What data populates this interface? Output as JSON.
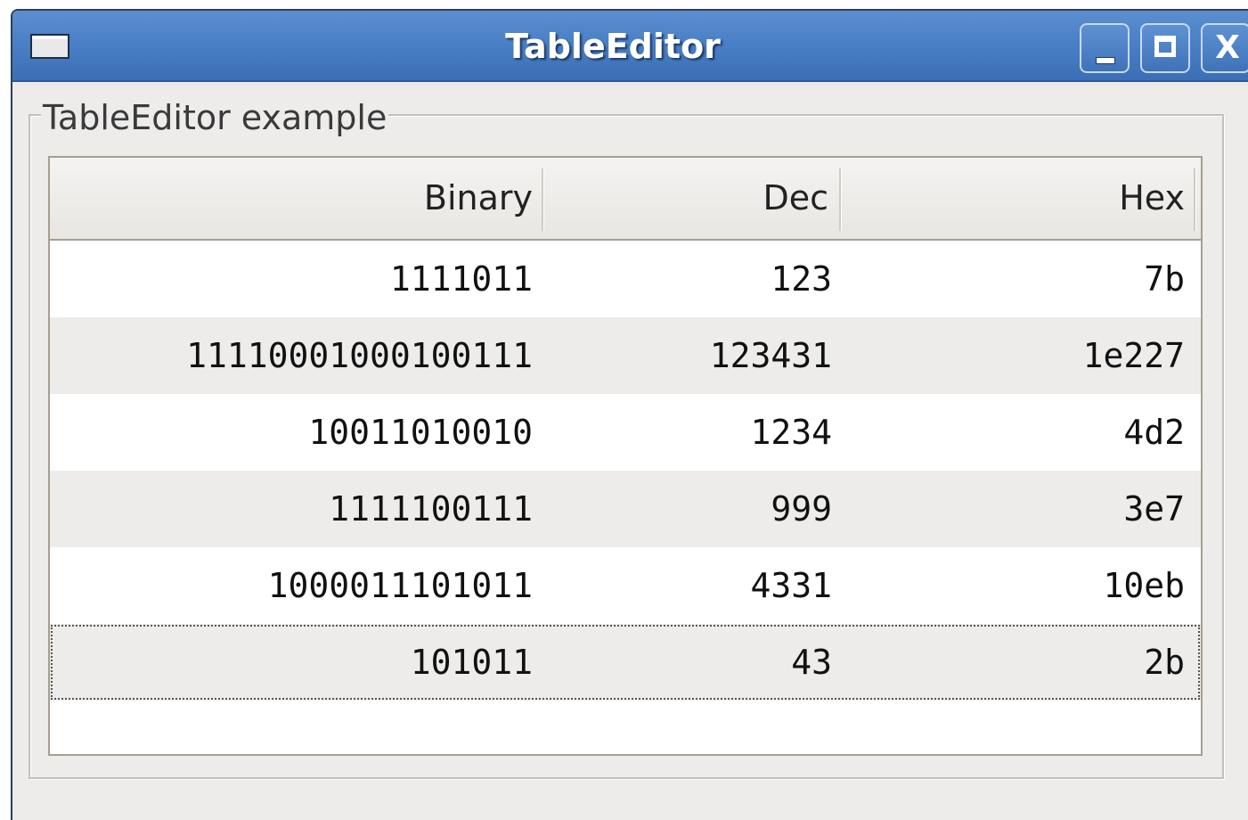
{
  "window": {
    "title": "TableEditor"
  },
  "titlebar": {
    "minimize_label": "_",
    "maximize_label": "",
    "close_label": "X"
  },
  "groupbox": {
    "title": "TableEditor example"
  },
  "table": {
    "columns": [
      "Binary",
      "Dec",
      "Hex"
    ],
    "rows": [
      {
        "binary": "1111011",
        "dec": "123",
        "hex": "7b"
      },
      {
        "binary": "11110001000100111",
        "dec": "123431",
        "hex": "1e227"
      },
      {
        "binary": "10011010010",
        "dec": "1234",
        "hex": "4d2"
      },
      {
        "binary": "1111100111",
        "dec": "999",
        "hex": "3e7"
      },
      {
        "binary": "1000011101011",
        "dec": "4331",
        "hex": "10eb"
      },
      {
        "binary": "101011",
        "dec": "43",
        "hex": "2b"
      }
    ],
    "current_row": 5
  },
  "icons": {
    "window_icon": "window-icon",
    "minimize": "minimize-icon",
    "maximize": "maximize-icon",
    "close": "close-icon"
  }
}
